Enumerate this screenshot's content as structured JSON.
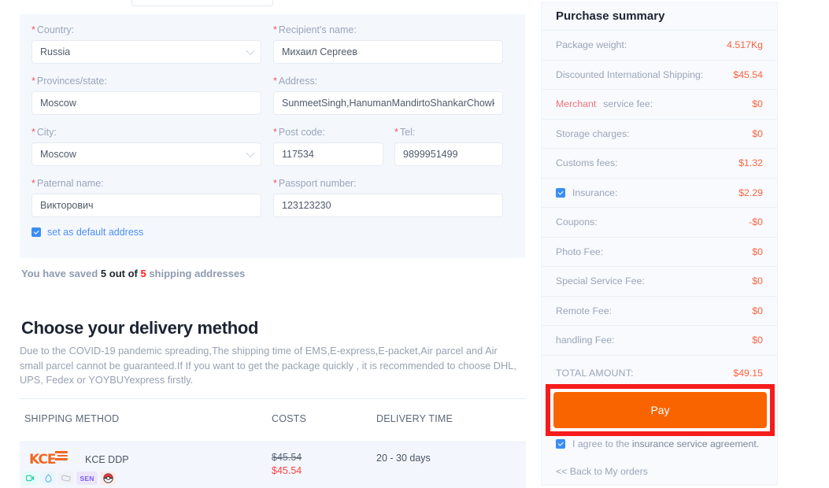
{
  "address_form": {
    "fields": [
      {
        "label": "Country:",
        "value": "Russia",
        "type": "select",
        "required": true
      },
      {
        "label": "Recipient's name:",
        "value": "Михаил Сергеев",
        "type": "text",
        "required": true
      },
      {
        "label": "Provinces/state:",
        "value": "Moscow",
        "type": "text",
        "required": true
      },
      {
        "label": "Address:",
        "value": "SunmeetSingh,HanumanMandirtoShankarChowkRoa",
        "type": "text",
        "required": true
      },
      {
        "label": "City:",
        "value": "Moscow",
        "type": "select",
        "required": true
      },
      {
        "label": "Post code:",
        "value": "117534",
        "type": "text",
        "required": true
      },
      {
        "label": "Tel:",
        "value": "9899951499",
        "type": "text",
        "required": true
      },
      {
        "label": "Paternal name:",
        "value": "Викторович",
        "type": "text",
        "required": true
      },
      {
        "label": "Passport number:",
        "value": "123123230",
        "type": "text",
        "required": true
      }
    ],
    "default_address_label": "set as default address",
    "default_address_checked": true,
    "saved_prefix": "You have saved ",
    "saved_count": "5 out of ",
    "saved_max": "5",
    "saved_suffix": " shipping addresses"
  },
  "delivery": {
    "title": "Choose your delivery method",
    "description": "Due to the COVID-19 pandemic spreading,The shipping time of EMS,E-express,E-packet,Air parcel and Air small parcel cannot be guaranteed.If If you want to get the package quickly , it is recommended to choose DHL, UPS, Fedex or YOYBUYexpress firstly.",
    "columns": {
      "method": "SHIPPING METHOD",
      "costs": "COSTS",
      "time": "DELIVERY TIME"
    },
    "rows": [
      {
        "carrier_logo": "KCE",
        "method_name": "KCE DDP",
        "badges": [
          "video-icon",
          "water-drop-icon",
          "bag-icon",
          "SEN",
          "pokeball-icon"
        ],
        "cost_original": "$45.54",
        "cost_discounted": "$45.54",
        "delivery_time": "20 - 30 days"
      }
    ]
  },
  "summary": {
    "title": "Purchase summary",
    "rows": [
      {
        "label": "Package weight:",
        "value": "4.517Kg",
        "checkbox": false
      },
      {
        "label": "Discounted International Shipping:",
        "value": "$45.54",
        "checkbox": false
      },
      {
        "label_highlight": "Merchant",
        "label": " service fee:",
        "value": "$0",
        "checkbox": false
      },
      {
        "label": "Storage charges:",
        "value": "$0",
        "checkbox": false
      },
      {
        "label": "Customs fees:",
        "value": "$1.32",
        "checkbox": false
      },
      {
        "label": "Insurance:",
        "value": "$2.29",
        "checkbox": true
      },
      {
        "label": "Coupons:",
        "value": "-$0",
        "checkbox": false
      },
      {
        "label": "Photo Fee:",
        "value": "$0",
        "checkbox": false
      },
      {
        "label": "Special Service Fee:",
        "value": "$0",
        "checkbox": false
      },
      {
        "label": "Remote Fee:",
        "value": "$0",
        "checkbox": false
      },
      {
        "label": "handling Fee:",
        "value": "$0",
        "checkbox": false
      }
    ],
    "total_label": "TOTAL AMOUNT:",
    "total_value": "$49.15",
    "pay_label": "Pay",
    "agree_prefix": "I agree to the ",
    "agree_link": "insurance service agreement.",
    "agree_checked": true,
    "back_link": "<< Back to My orders"
  },
  "colors": {
    "accent_orange": "#fa6400",
    "highlight_red": "#f71c1c",
    "value_orange": "#fb6340",
    "label_gray": "#9aa5b8",
    "panel_bg": "#f4f8fd",
    "link_blue": "#4e8ef7"
  }
}
